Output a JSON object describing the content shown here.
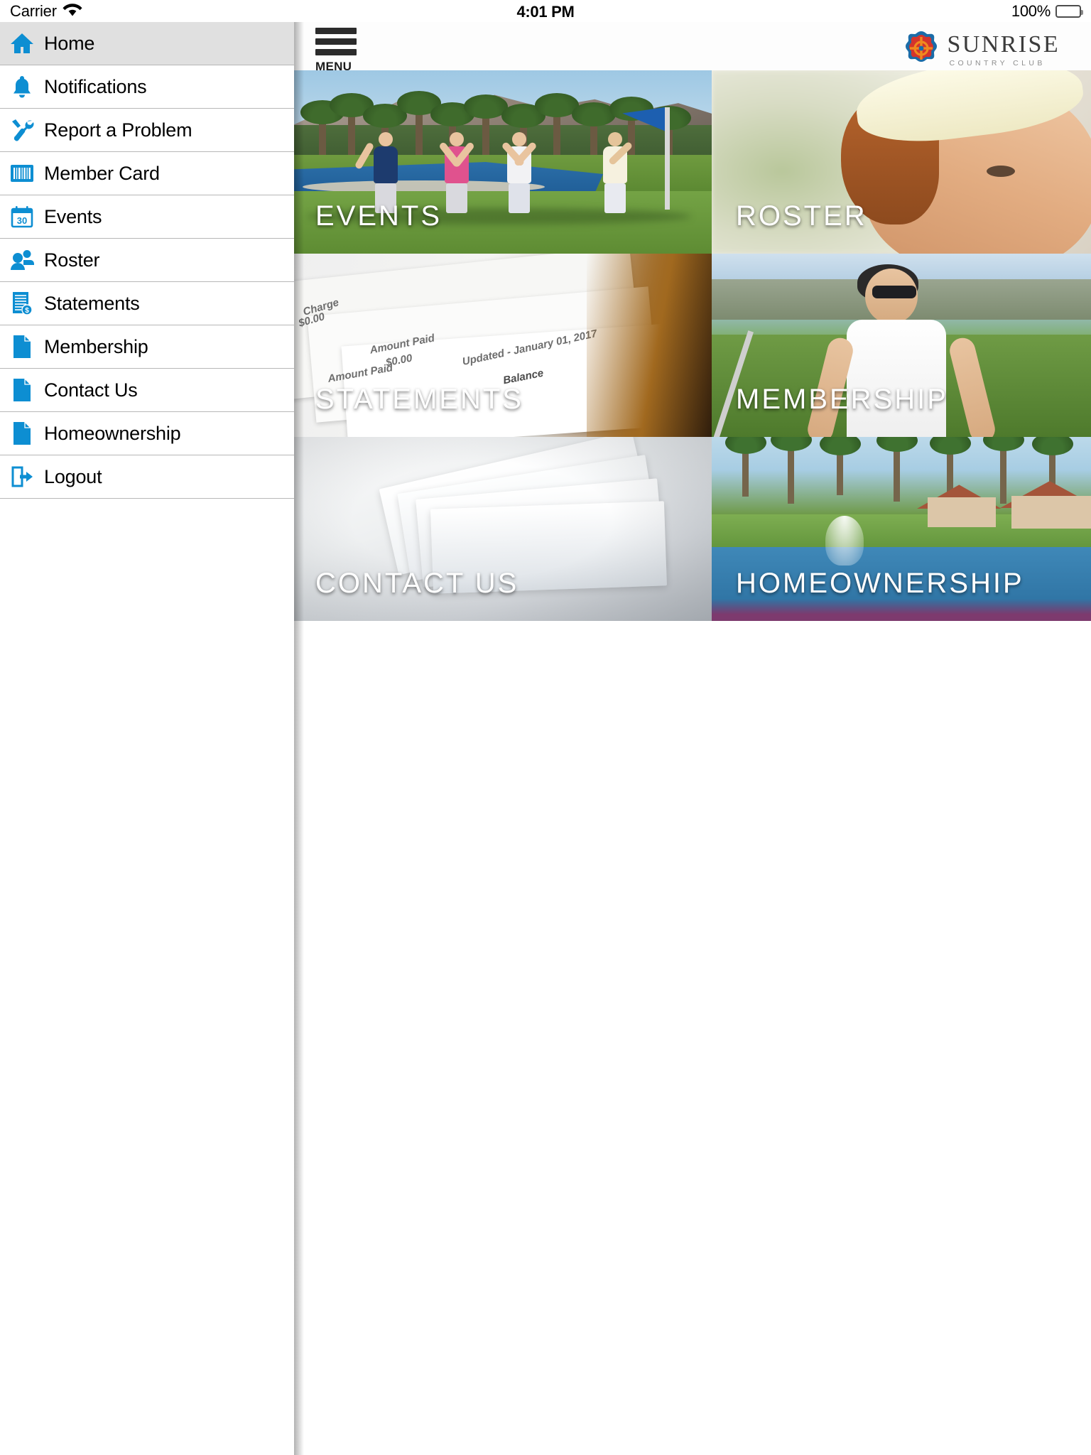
{
  "status_bar": {
    "carrier": "Carrier",
    "wifi_icon": "wifi-icon",
    "time": "4:01 PM",
    "battery_percent": "100%",
    "battery_icon": "battery-full-icon"
  },
  "header": {
    "menu_icon": "hamburger-menu-icon",
    "menu_label": "MENU",
    "logo": {
      "emblem_icon": "sunrise-country-club-emblem",
      "name": "SUNRISE",
      "tagline": "COUNTRY CLUB",
      "emblem_colors": {
        "outer": "#1b6ca8",
        "inner": "#d4342c",
        "center": "#f08a1e"
      }
    }
  },
  "sidebar": {
    "selected_index": 0,
    "items": [
      {
        "label": "Home",
        "icon": "home-icon",
        "selected": true
      },
      {
        "label": "Notifications",
        "icon": "bell-icon",
        "selected": false
      },
      {
        "label": "Report a Problem",
        "icon": "tools-icon",
        "selected": false
      },
      {
        "label": "Member Card",
        "icon": "barcode-icon",
        "selected": false
      },
      {
        "label": "Events",
        "icon": "calendar-30-icon",
        "selected": false
      },
      {
        "label": "Roster",
        "icon": "people-icon",
        "selected": false
      },
      {
        "label": "Statements",
        "icon": "document-dollar-icon",
        "selected": false
      },
      {
        "label": "Membership",
        "icon": "page-icon",
        "selected": false
      },
      {
        "label": "Contact Us",
        "icon": "page-icon",
        "selected": false
      },
      {
        "label": "Homeownership",
        "icon": "page-icon",
        "selected": false
      },
      {
        "label": "Logout",
        "icon": "logout-arrow-icon",
        "selected": false
      }
    ],
    "icon_color": "#0d8ed2",
    "selected_background": "#e0e0e0"
  },
  "tiles": [
    {
      "label": "EVENTS",
      "image": "golfers-celebrating-on-green-photo"
    },
    {
      "label": "ROSTER",
      "image": "woman-in-white-visor-photo"
    },
    {
      "label": "STATEMENTS",
      "image": "printed-statement-papers-photo"
    },
    {
      "label": "MEMBERSHIP",
      "image": "woman-golfer-with-club-photo"
    },
    {
      "label": "CONTACT US",
      "image": "stack-of-blank-sheets-photo"
    },
    {
      "label": "HOMEOWNERSHIP",
      "image": "homes-by-lake-with-fountain-photo"
    }
  ],
  "statement_photo_text": {
    "charge": "Charge",
    "amount_paid_1": "Amount Paid",
    "amount_paid_2": "Amount Paid",
    "zero_1": "$0.00",
    "zero_2": "$0.00",
    "updated": "Updated - January 01, 2017",
    "balance": "Balance"
  }
}
